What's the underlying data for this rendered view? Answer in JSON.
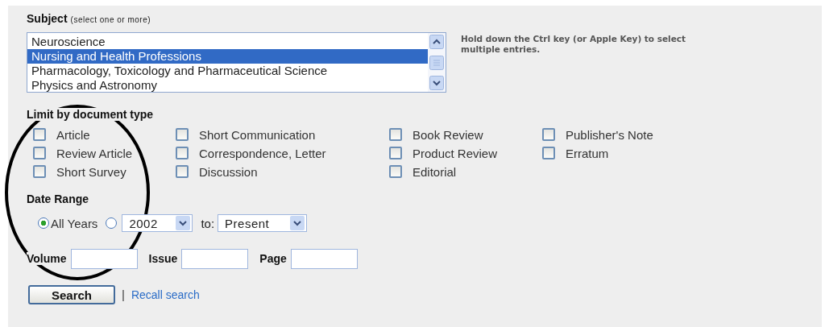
{
  "subject": {
    "label": "Subject",
    "hint": "(select one or more)",
    "options": [
      {
        "label": "Neuroscience",
        "selected": false
      },
      {
        "label": "Nursing and Health Professions",
        "selected": true
      },
      {
        "label": "Pharmacology, Toxicology and Pharmaceutical Science",
        "selected": false
      },
      {
        "label": "Physics and Astronomy",
        "selected": false
      }
    ],
    "note": "Hold down the Ctrl key (or Apple Key) to select multiple entries."
  },
  "document_type": {
    "heading": "Limit by document type",
    "columns": [
      [
        {
          "label": "Article",
          "checked": false
        },
        {
          "label": "Review Article",
          "checked": false
        },
        {
          "label": "Short Survey",
          "checked": false
        }
      ],
      [
        {
          "label": "Short Communication",
          "checked": false
        },
        {
          "label": "Correspondence, Letter",
          "checked": false
        },
        {
          "label": "Discussion",
          "checked": false
        }
      ],
      [
        {
          "label": "Book Review",
          "checked": false
        },
        {
          "label": "Product Review",
          "checked": false
        },
        {
          "label": "Editorial",
          "checked": false
        }
      ],
      [
        {
          "label": "Publisher's Note",
          "checked": false
        },
        {
          "label": "Erratum",
          "checked": false
        }
      ]
    ]
  },
  "date_range": {
    "heading": "Date Range",
    "all_years": {
      "label": "All Years",
      "selected": true
    },
    "range": {
      "selected": false,
      "from": "2002",
      "to_label": "to:",
      "to": "Present"
    }
  },
  "fields": [
    {
      "label": "Volume"
    },
    {
      "label": "Issue"
    },
    {
      "label": "Page"
    }
  ],
  "search_button": "Search",
  "separator": "|",
  "recall_link": "Recall search"
}
